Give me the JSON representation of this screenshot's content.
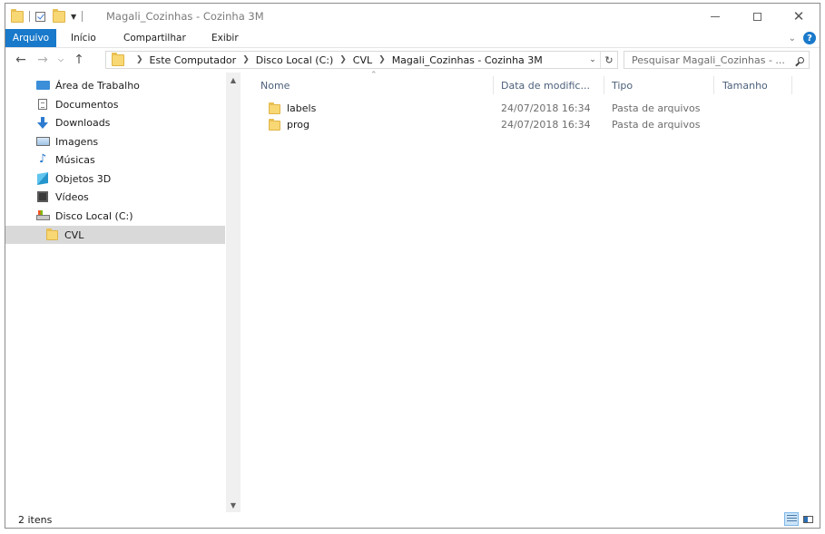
{
  "window": {
    "title": "Magali_Cozinhas - Cozinha 3M"
  },
  "ribbon": {
    "tabs": [
      "Arquivo",
      "Início",
      "Compartilhar",
      "Exibir"
    ]
  },
  "address": {
    "crumbs": [
      "Este Computador",
      "Disco Local (C:)",
      "CVL",
      "Magali_Cozinhas - Cozinha 3M"
    ]
  },
  "search": {
    "placeholder": "Pesquisar Magali_Cozinhas - ..."
  },
  "sidebar": {
    "items": [
      {
        "label": "Área de Trabalho",
        "icon": "desktop-icon"
      },
      {
        "label": "Documentos",
        "icon": "documents-icon"
      },
      {
        "label": "Downloads",
        "icon": "downloads-icon"
      },
      {
        "label": "Imagens",
        "icon": "pictures-icon"
      },
      {
        "label": "Músicas",
        "icon": "music-icon"
      },
      {
        "label": "Objetos 3D",
        "icon": "3d-objects-icon"
      },
      {
        "label": "Vídeos",
        "icon": "videos-icon"
      },
      {
        "label": "Disco Local (C:)",
        "icon": "drive-icon"
      },
      {
        "label": "CVL",
        "icon": "folder-icon",
        "selected": true
      }
    ]
  },
  "columns": [
    "Nome",
    "Data de modific...",
    "Tipo",
    "Tamanho"
  ],
  "files": [
    {
      "name": "labels",
      "date": "24/07/2018 16:34",
      "type": "Pasta de arquivos",
      "size": ""
    },
    {
      "name": "prog",
      "date": "24/07/2018 16:34",
      "type": "Pasta de arquivos",
      "size": ""
    }
  ],
  "status": {
    "item_count": "2 itens"
  },
  "colors": {
    "accent": "#1979ca",
    "selection": "#d9d9d9",
    "folder": "#f8d775"
  }
}
